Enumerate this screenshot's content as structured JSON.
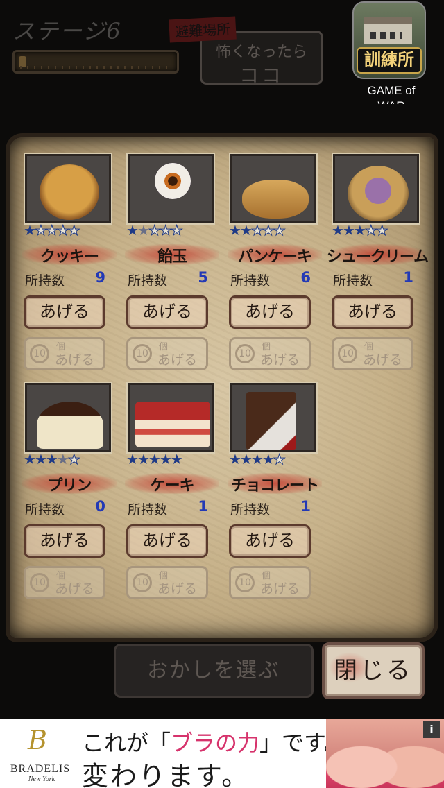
{
  "header": {
    "stage": "ステージ6",
    "shelter_tag": "避難場所",
    "shelter_line1": "怖くなったら",
    "shelter_line2": "ココ",
    "fear_level": 0.05
  },
  "ad_icon": {
    "badge": "訓練所",
    "caption": "GAME of WAR"
  },
  "sweets": [
    {
      "name": "クッキー",
      "stars": 1,
      "count_label": "所持数",
      "count": "9",
      "give": "あげる",
      "give10_unit": "個",
      "give10_num": "10",
      "give10": "あげる",
      "icon": "cookie-icon"
    },
    {
      "name": "飴玉",
      "stars": 1.5,
      "count_label": "所持数",
      "count": "5",
      "give": "あげる",
      "give10_unit": "個",
      "give10_num": "10",
      "give10": "あげる",
      "icon": "candy-icon"
    },
    {
      "name": "パンケーキ",
      "stars": 2,
      "count_label": "所持数",
      "count": "6",
      "give": "あげる",
      "give10_unit": "個",
      "give10_num": "10",
      "give10": "あげる",
      "icon": "pancake-icon"
    },
    {
      "name": "シュークリーム",
      "stars": 3,
      "count_label": "所持数",
      "count": "1",
      "give": "あげる",
      "give10_unit": "個",
      "give10_num": "10",
      "give10": "あげる",
      "icon": "cream-puff-icon"
    },
    {
      "name": "プリン",
      "stars": 3.5,
      "count_label": "所持数",
      "count": "0",
      "give": "あげる",
      "give10_unit": "個",
      "give10_num": "10",
      "give10": "あげる",
      "icon": "pudding-icon"
    },
    {
      "name": "ケーキ",
      "stars": 5,
      "count_label": "所持数",
      "count": "1",
      "give": "あげる",
      "give10_unit": "個",
      "give10_num": "10",
      "give10": "あげる",
      "icon": "cake-icon"
    },
    {
      "name": "チョコレート",
      "stars": 4,
      "count_label": "所持数",
      "count": "1",
      "give": "あげる",
      "give10_unit": "個",
      "give10_num": "10",
      "give10": "あげる",
      "icon": "chocolate-icon"
    }
  ],
  "footer": {
    "select_label": "おかしを選ぶ",
    "close_label": "閉じる"
  },
  "banner": {
    "brand_logo": "B",
    "brand_name": "BRADELIS",
    "brand_city": "New York",
    "line1_pre": "これが「",
    "line1_accent": "ブラの力",
    "line1_post": "」です。",
    "line2": "変わります。",
    "info": "i"
  }
}
